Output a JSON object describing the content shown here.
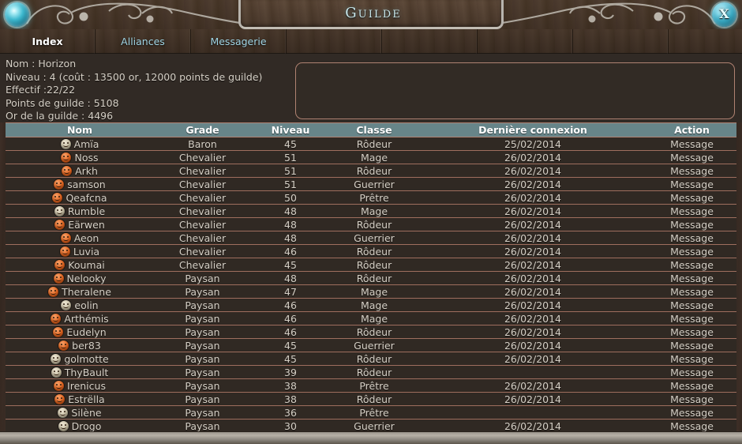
{
  "window": {
    "title": "Guilde",
    "close_label": "X"
  },
  "tabs": [
    {
      "label": "Index",
      "active": true
    },
    {
      "label": "Alliances",
      "active": false
    },
    {
      "label": "Messagerie",
      "active": false
    }
  ],
  "empty_tab_count": 5,
  "guild_info": {
    "name_line": "Nom : Horizon",
    "level_line": "Niveau : 4 (coût : 13500 or, 12000 points de guilde)",
    "members_line": "Effectif :22/22",
    "points_line": "Points de guilde : 5108",
    "gold_line": "Or de la guilde : 4496"
  },
  "notebox": {
    "value": ""
  },
  "table": {
    "columns": [
      "Nom",
      "Grade",
      "Niveau",
      "Classe",
      "Dernière connexion",
      "Action"
    ],
    "rows": [
      {
        "icon": "smiley-face-offline-icon",
        "online": false,
        "name": "Amïa",
        "grade": "Baron",
        "level": "45",
        "class": "Rôdeur",
        "last": "25/02/2014",
        "action": "Message"
      },
      {
        "icon": "smiley-face-online-icon",
        "online": true,
        "name": "Noss",
        "grade": "Chevalier",
        "level": "51",
        "class": "Mage",
        "last": "26/02/2014",
        "action": "Message"
      },
      {
        "icon": "smiley-face-online-icon",
        "online": true,
        "name": "Arkh",
        "grade": "Chevalier",
        "level": "51",
        "class": "Rôdeur",
        "last": "26/02/2014",
        "action": "Message"
      },
      {
        "icon": "smiley-face-online-icon",
        "online": true,
        "name": "samson",
        "grade": "Chevalier",
        "level": "51",
        "class": "Guerrier",
        "last": "26/02/2014",
        "action": "Message"
      },
      {
        "icon": "smiley-face-online-icon",
        "online": true,
        "name": "Qeafcna",
        "grade": "Chevalier",
        "level": "50",
        "class": "Prêtre",
        "last": "26/02/2014",
        "action": "Message"
      },
      {
        "icon": "smiley-face-offline-icon",
        "online": false,
        "name": "Rumble",
        "grade": "Chevalier",
        "level": "48",
        "class": "Mage",
        "last": "26/02/2014",
        "action": "Message"
      },
      {
        "icon": "smiley-face-online-icon",
        "online": true,
        "name": "Eärwen",
        "grade": "Chevalier",
        "level": "48",
        "class": "Rôdeur",
        "last": "26/02/2014",
        "action": "Message"
      },
      {
        "icon": "smiley-face-online-icon",
        "online": true,
        "name": "Aeon",
        "grade": "Chevalier",
        "level": "48",
        "class": "Guerrier",
        "last": "26/02/2014",
        "action": "Message"
      },
      {
        "icon": "smiley-face-online-icon",
        "online": true,
        "name": "Luvia",
        "grade": "Chevalier",
        "level": "46",
        "class": "Rôdeur",
        "last": "26/02/2014",
        "action": "Message"
      },
      {
        "icon": "smiley-face-online-icon",
        "online": true,
        "name": "Koumai",
        "grade": "Chevalier",
        "level": "45",
        "class": "Rôdeur",
        "last": "26/02/2014",
        "action": "Message"
      },
      {
        "icon": "smiley-face-online-icon",
        "online": true,
        "name": "Nelooky",
        "grade": "Paysan",
        "level": "48",
        "class": "Rôdeur",
        "last": "26/02/2014",
        "action": "Message"
      },
      {
        "icon": "smiley-face-online-icon",
        "online": true,
        "name": "Theralene",
        "grade": "Paysan",
        "level": "47",
        "class": "Mage",
        "last": "26/02/2014",
        "action": "Message"
      },
      {
        "icon": "smiley-face-offline-icon",
        "online": false,
        "name": "eolin",
        "grade": "Paysan",
        "level": "46",
        "class": "Mage",
        "last": "26/02/2014",
        "action": "Message"
      },
      {
        "icon": "smiley-face-online-icon",
        "online": true,
        "name": "Arthémis",
        "grade": "Paysan",
        "level": "46",
        "class": "Mage",
        "last": "26/02/2014",
        "action": "Message"
      },
      {
        "icon": "smiley-face-online-icon",
        "online": true,
        "name": "Eudelyn",
        "grade": "Paysan",
        "level": "46",
        "class": "Rôdeur",
        "last": "26/02/2014",
        "action": "Message"
      },
      {
        "icon": "smiley-face-online-icon",
        "online": true,
        "name": "ber83",
        "grade": "Paysan",
        "level": "45",
        "class": "Guerrier",
        "last": "26/02/2014",
        "action": "Message"
      },
      {
        "icon": "smiley-face-offline-icon",
        "online": false,
        "name": "golmotte",
        "grade": "Paysan",
        "level": "45",
        "class": "Rôdeur",
        "last": "26/02/2014",
        "action": "Message"
      },
      {
        "icon": "smiley-face-offline-icon",
        "online": false,
        "name": "ThyBault",
        "grade": "Paysan",
        "level": "39",
        "class": "Rôdeur",
        "last": "",
        "action": "Message"
      },
      {
        "icon": "smiley-face-online-icon",
        "online": true,
        "name": "Irenicus",
        "grade": "Paysan",
        "level": "38",
        "class": "Prêtre",
        "last": "26/02/2014",
        "action": "Message"
      },
      {
        "icon": "smiley-face-online-icon",
        "online": true,
        "name": "Estrëlla",
        "grade": "Paysan",
        "level": "38",
        "class": "Rôdeur",
        "last": "26/02/2014",
        "action": "Message"
      },
      {
        "icon": "smiley-face-offline-icon",
        "online": false,
        "name": "Silène",
        "grade": "Paysan",
        "level": "36",
        "class": "Prêtre",
        "last": "",
        "action": "Message"
      },
      {
        "icon": "smiley-face-offline-icon",
        "online": false,
        "name": "Drogo",
        "grade": "Paysan",
        "level": "30",
        "class": "Guerrier",
        "last": "26/02/2014",
        "action": "Message"
      }
    ]
  },
  "colors": {
    "header_bg": "#678589",
    "row_bg": "#302923",
    "row_border": "#9e6e5e",
    "name_link": "#8fd0e2",
    "action_link": "#f09f82",
    "title_text": "#c9e8ec",
    "orb_glow": "#3fb9cf"
  }
}
